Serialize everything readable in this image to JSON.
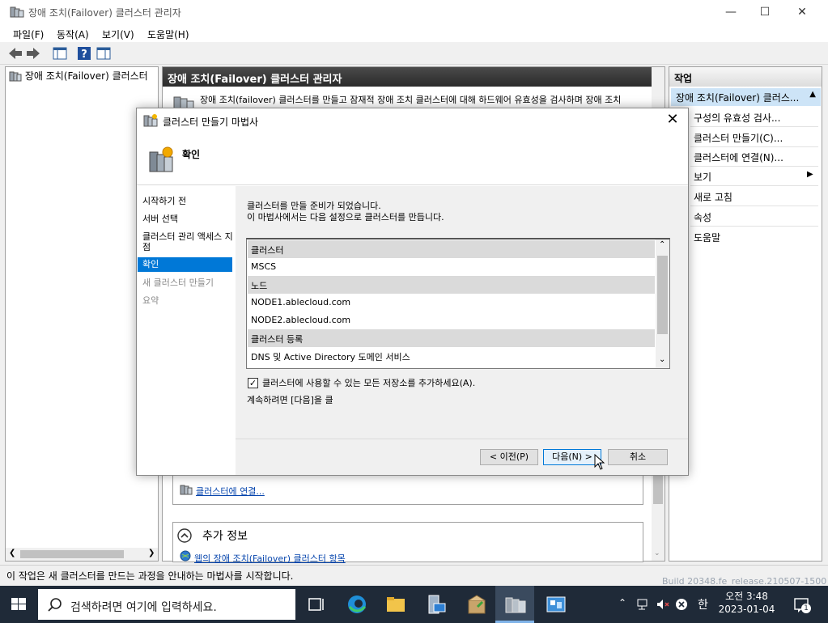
{
  "window": {
    "title": "장애 조치(Failover) 클러스터 관리자",
    "menu": [
      "파일(F)",
      "동작(A)",
      "보기(V)",
      "도움말(H)"
    ]
  },
  "tree": {
    "root": "장애 조치(Failover) 클러스터"
  },
  "center": {
    "header": "장애 조치(Failover) 클러스터 관리자",
    "description_partial": "장애 조치(failover) 클러스터를 만들고 잠재적 장애 조치 클러스터에 대해 하드웨어 유효성을 검사하며 장애 조치",
    "connect_link": "클러스터에 연결...",
    "more_info_title": "추가 정보",
    "web_link": "웹의 장애 조치(Failover) 클러스터 항목"
  },
  "actions": {
    "header": "작업",
    "selected": "장애 조치(Failover) 클러스...",
    "items": [
      "구성의 유효성 검사...",
      "클러스터 만들기(C)...",
      "클러스터에 연결(N)...",
      "보기",
      "새로 고침",
      "속성",
      "도움말"
    ]
  },
  "status": "이 작업은 새 클러스터를 만드는 과정을 안내하는 마법사를 시작합니다.",
  "wizard": {
    "title": "클러스터 만들기 마법사",
    "step_title": "확인",
    "steps": [
      {
        "label": "시작하기 전",
        "state": "normal"
      },
      {
        "label": "서버 선택",
        "state": "normal"
      },
      {
        "label": "클러스터 관리 액세스 지점",
        "state": "normal"
      },
      {
        "label": "확인",
        "state": "active"
      },
      {
        "label": "새 클러스터 만들기",
        "state": "disabled"
      },
      {
        "label": "요약",
        "state": "disabled"
      }
    ],
    "intro_line1": "클러스터를 만들 준비가 되었습니다.",
    "intro_line2": "이 마법사에서는 다음 설정으로 클러스터를 만듭니다.",
    "rows": [
      {
        "text": "클러스터",
        "group": true
      },
      {
        "text": "MSCS",
        "group": false
      },
      {
        "text": "노드",
        "group": true
      },
      {
        "text": "NODE1.ablecloud.com",
        "group": false
      },
      {
        "text": "NODE2.ablecloud.com",
        "group": false
      },
      {
        "text": "클러스터 등록",
        "group": true
      },
      {
        "text": "DNS 및 Active Directory 도메인 서비스",
        "group": false
      }
    ],
    "checkbox_label": "클러스터에 사용할 수 있는 모든 저장소를 추가하세요(A).",
    "checkbox_checked": true,
    "continue_text": "계속하려면 [다음]을 클",
    "buttons": {
      "prev": "< 이전(P)",
      "next": "다음(N) >",
      "cancel": "취소"
    }
  },
  "taskbar": {
    "search_placeholder": "검색하려면 여기에 입력하세요.",
    "time": "오전 3:48",
    "date": "2023-01-04",
    "notification_count": "1",
    "ime": "한",
    "build_partial": "Build 20348.fe_release.210507-1500"
  }
}
